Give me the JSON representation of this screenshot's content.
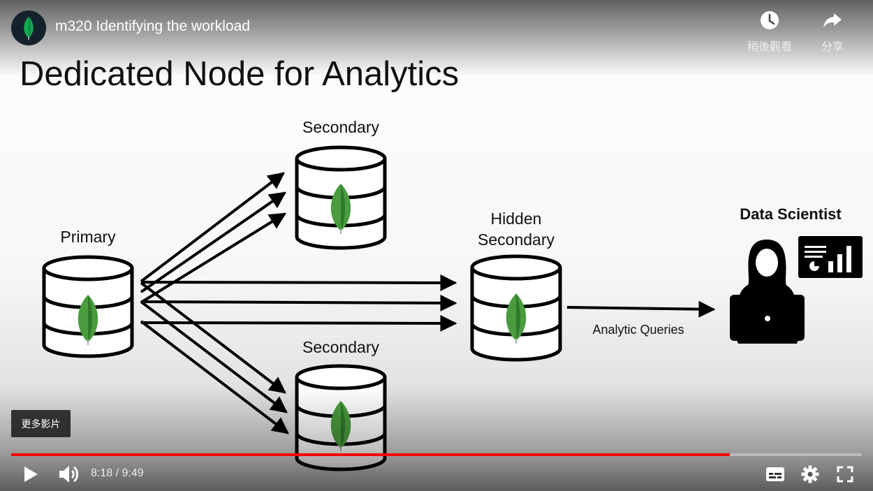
{
  "video": {
    "title": "m320 Identifying the workload",
    "channel_icon": "mongodb-leaf-icon"
  },
  "top_actions": {
    "watch_later_label": "稍後觀看",
    "watch_later_icon": "clock-icon",
    "share_label": "分享",
    "share_icon": "share-arrow-icon"
  },
  "slide": {
    "title": "Dedicated Node for Analytics",
    "labels": {
      "primary": "Primary",
      "secondary_top": "Secondary",
      "secondary_bottom": "Secondary",
      "hidden_line1": "Hidden",
      "hidden_line2": "Secondary",
      "data_scientist": "Data Scientist",
      "analytic_queries": "Analytic Queries"
    }
  },
  "more_videos": {
    "label": "更多影片"
  },
  "playback": {
    "current_time": "8:18",
    "separator": " / ",
    "duration": "9:49",
    "progress_fraction": 0.845
  },
  "colors": {
    "progress": "#ff0000",
    "leaf_fill": "#4a9c3f",
    "leaf_shade": "#2f7a2a",
    "avatar_bg": "#14232b"
  },
  "controls": {
    "play_icon": "play-icon",
    "volume_icon": "volume-icon",
    "subtitles_icon": "subtitles-icon",
    "settings_icon": "gear-icon",
    "fullscreen_icon": "fullscreen-icon"
  }
}
